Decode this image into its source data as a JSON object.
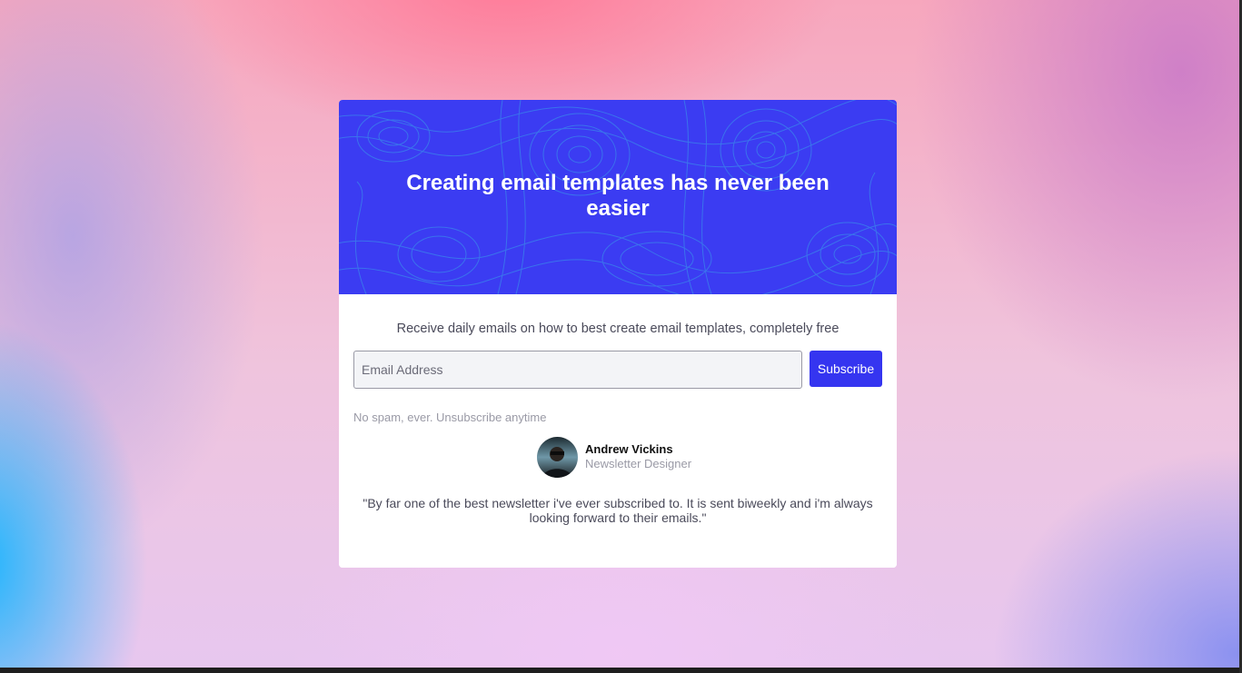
{
  "hero": {
    "title": "Creating email templates has never been easier"
  },
  "signup": {
    "lead": "Receive daily emails on how to best create email templates, completely free",
    "email_placeholder": "Email Address",
    "email_value": "",
    "subscribe_label": "Subscribe",
    "note": "No spam, ever. Unsubscribe anytime"
  },
  "testimonial": {
    "name": "Andrew Vickins",
    "role": "Newsletter Designer",
    "quote": "\"By far one of the best newsletter i've ever subscribed to. It is sent biweekly and i'm always looking forward to their emails.\""
  },
  "colors": {
    "accent": "#3535f0",
    "hero_bg": "#3b3cf2",
    "contour": "#3aa0e8"
  }
}
